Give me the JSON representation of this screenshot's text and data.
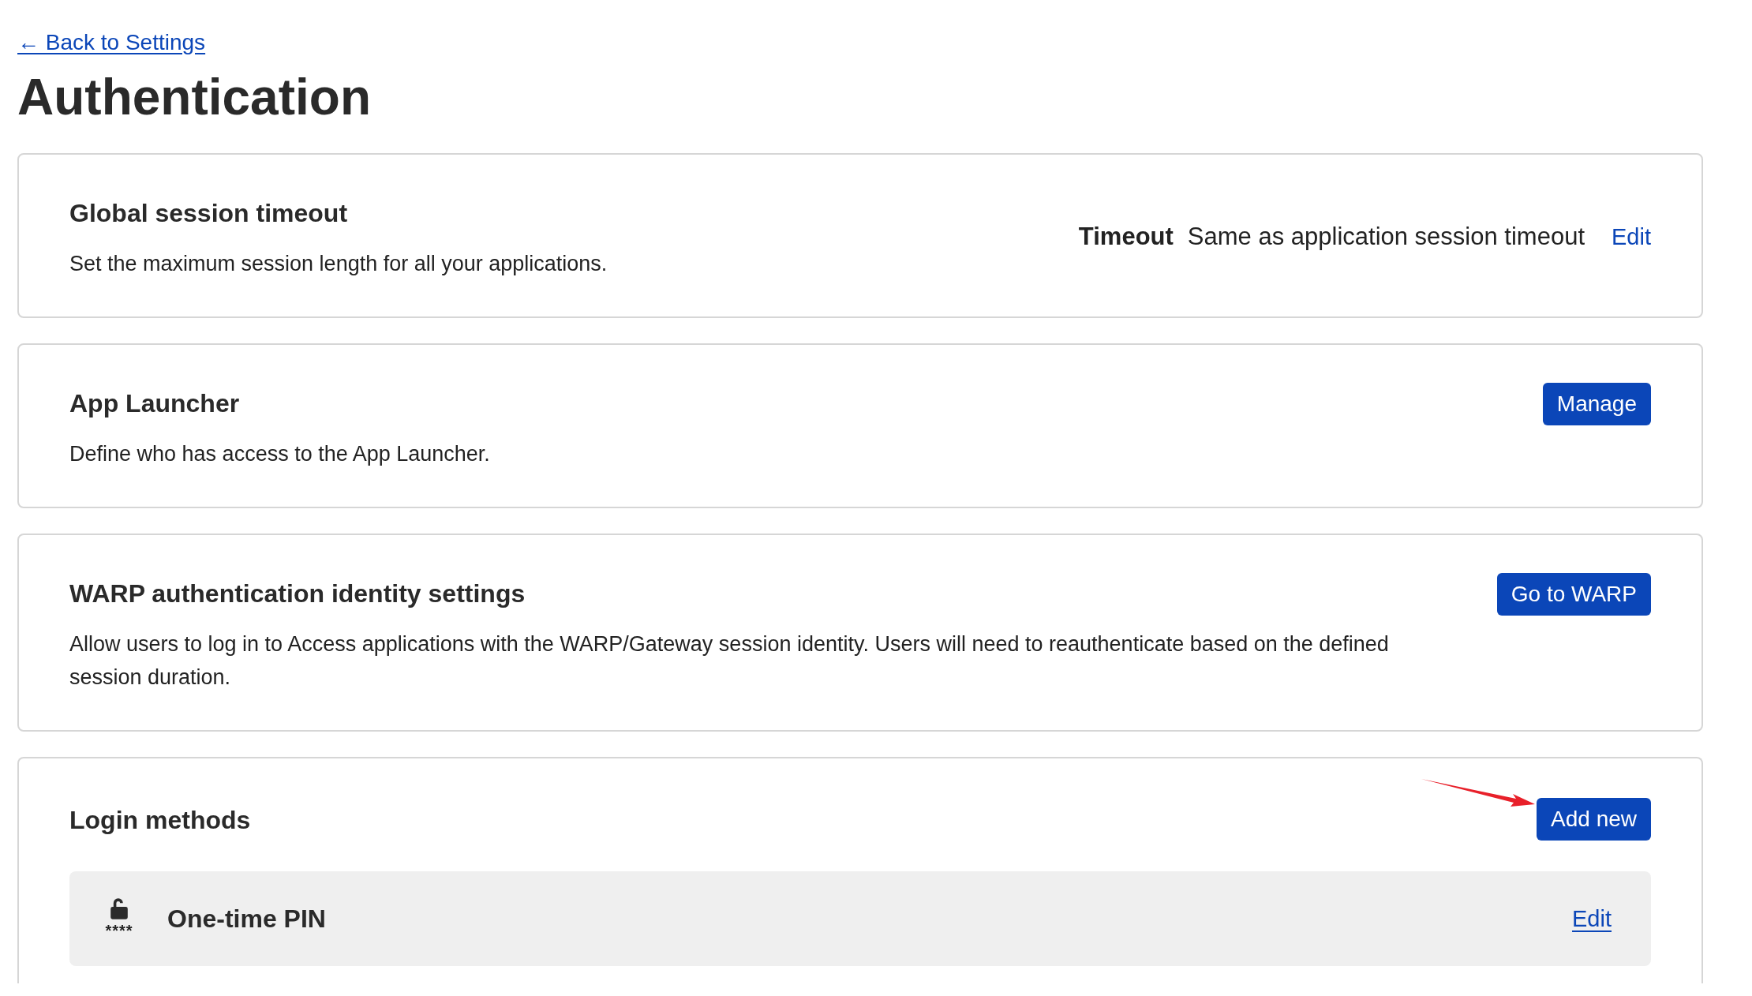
{
  "back_link": {
    "arrow": "←",
    "label": "Back to Settings"
  },
  "page_title": "Authentication",
  "cards": [
    {
      "kind": "setting",
      "title": "Global session timeout",
      "description": "Set the maximum session length for all your applications.",
      "setting_label": "Timeout",
      "setting_value": "Same as application session timeout",
      "action": "Edit"
    },
    {
      "kind": "button",
      "title": "App Launcher",
      "description": "Define who has access to the App Launcher.",
      "action": "Manage"
    },
    {
      "kind": "button",
      "title": "WARP authentication identity settings",
      "description": "Allow users to log in to Access applications with the WARP/Gateway session identity. Users will need to reauthenticate based on the defined session duration.",
      "action": "Go to WARP"
    },
    {
      "kind": "list",
      "title": "Login methods",
      "action": "Add new",
      "annotated": true,
      "methods": [
        {
          "name": "One-time PIN",
          "icon_caption": "****",
          "action": "Edit"
        }
      ]
    }
  ]
}
